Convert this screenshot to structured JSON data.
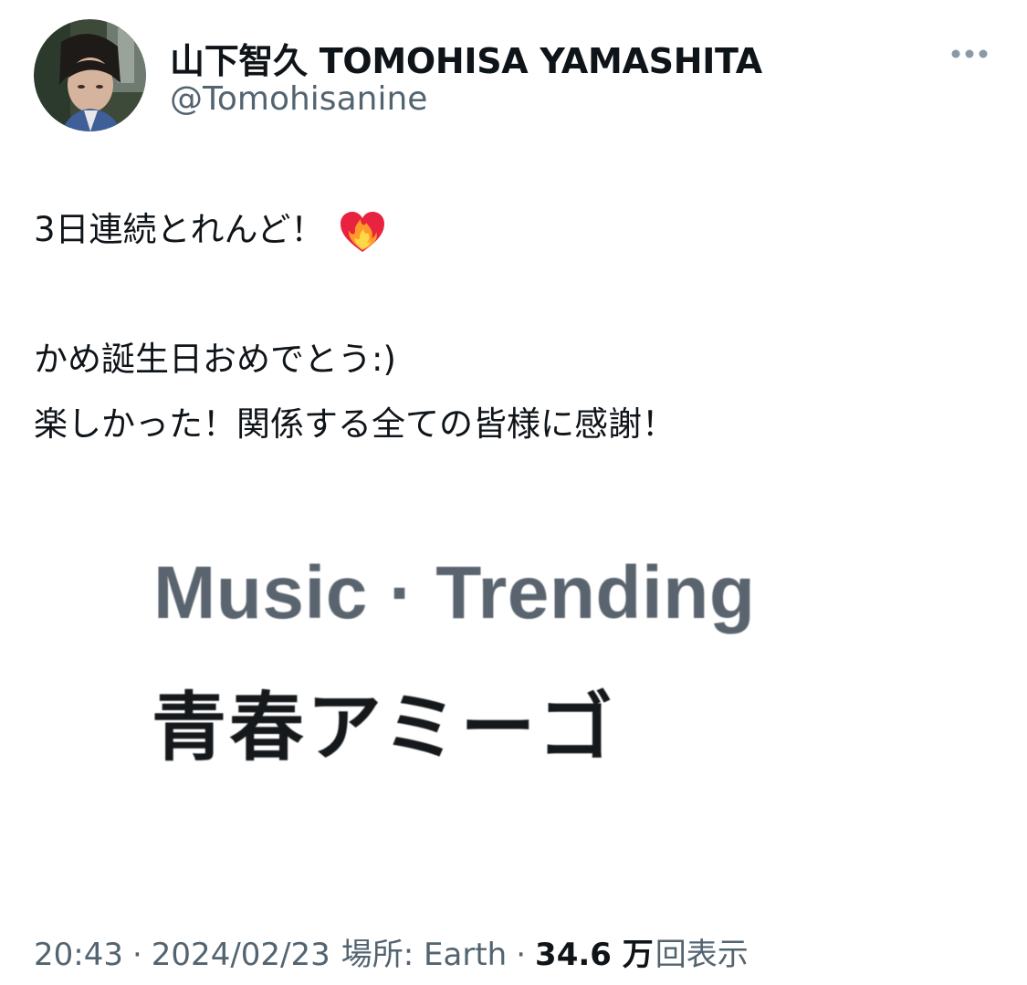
{
  "author": {
    "display_name": "山下智久 TOMOHISA YAMASHITA",
    "handle": "@Tomohisanine"
  },
  "tweet": {
    "lines": [
      "3日連続とれんど！",
      "",
      "かめ誕生日おめでとう:)",
      "楽しかった！関係する全ての皆様に感謝！"
    ],
    "emoji": "heart-on-fire"
  },
  "media": {
    "category": "Music · Trending",
    "title": "青春アミーゴ"
  },
  "meta": {
    "time": "20:43",
    "date": "2024/02/23",
    "location_label": "場所: Earth",
    "views_count": "34.6 万",
    "views_label": "回表示",
    "separator": "·"
  },
  "colors": {
    "text_primary": "#0f1419",
    "text_secondary": "#536471",
    "background": "#ffffff"
  },
  "icons": {
    "more": "more-horizontal-icon",
    "avatar": "profile-photo"
  }
}
